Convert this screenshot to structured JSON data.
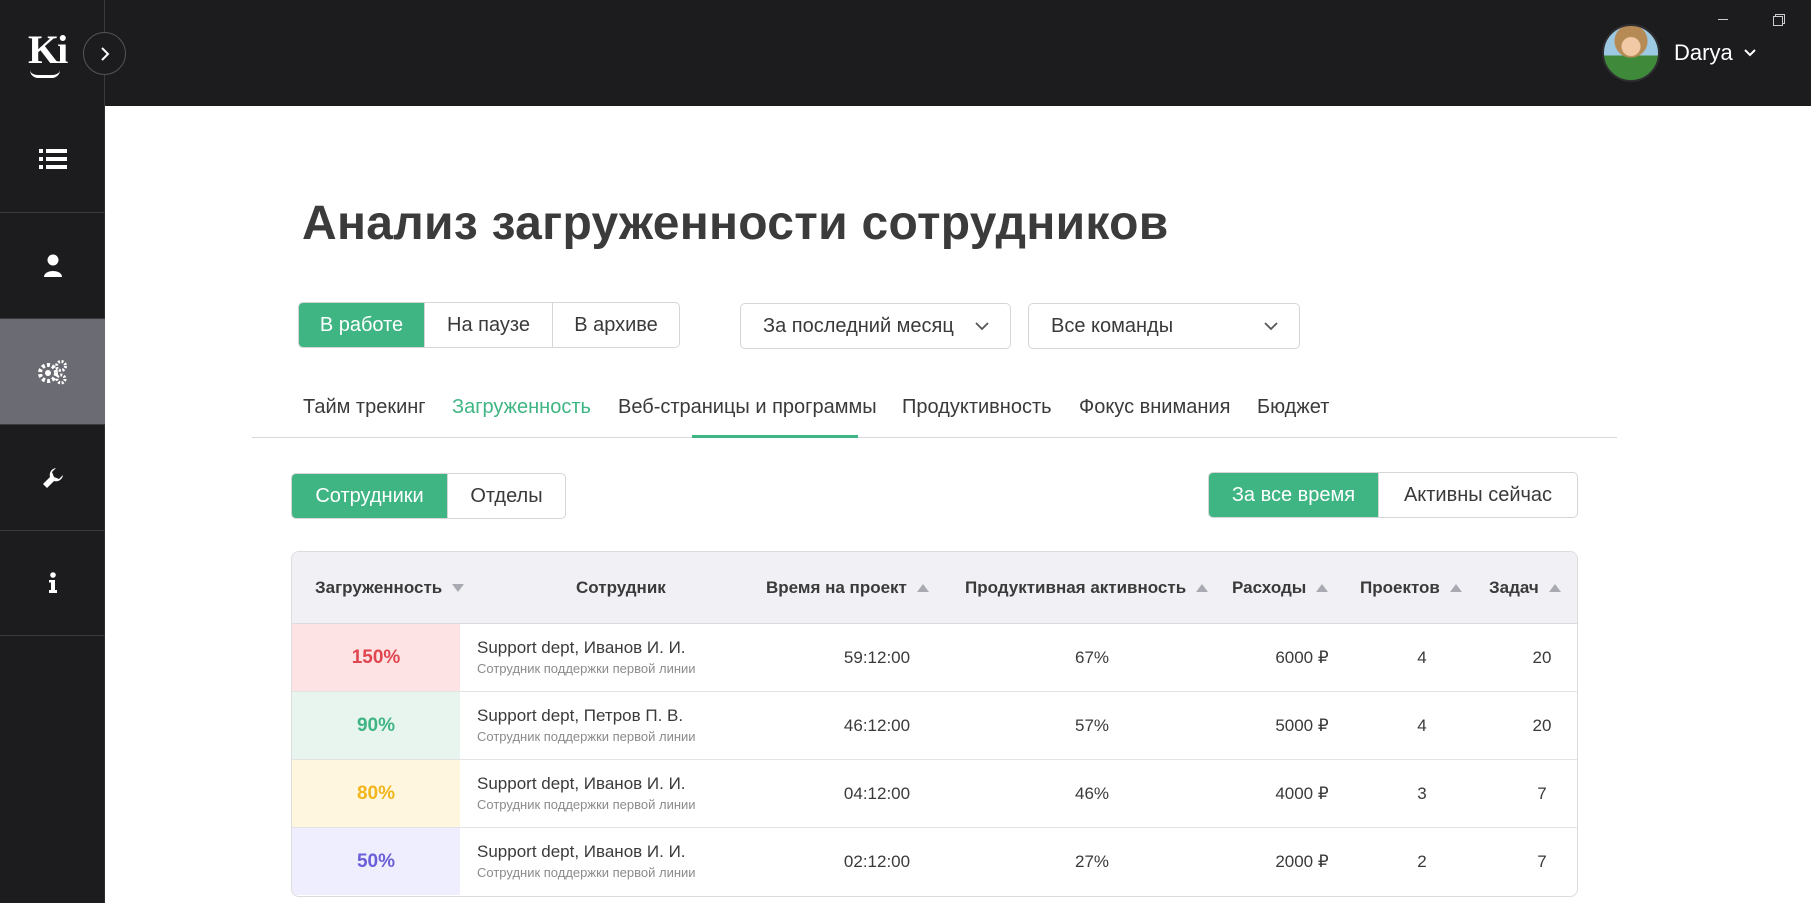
{
  "header": {
    "logo_text": "Ki",
    "user_name": "Darya",
    "icons": {
      "expand": "chevron-right-icon",
      "user_menu": "chevron-down-icon"
    }
  },
  "sidebar": {
    "items": [
      {
        "name": "list",
        "icon": "list-icon",
        "active": false
      },
      {
        "name": "user",
        "icon": "user-icon",
        "active": false
      },
      {
        "name": "settings",
        "icon": "gears-icon",
        "active": true
      },
      {
        "name": "tools",
        "icon": "wrench-icon",
        "active": false
      },
      {
        "name": "info",
        "icon": "info-icon",
        "active": false
      }
    ]
  },
  "page": {
    "title": "Анализ загруженности сотрудников"
  },
  "filters": {
    "status": [
      "В работе",
      "На паузе",
      "В архиве"
    ],
    "status_selected": "В работе",
    "period": "За последний месяц",
    "teams": "Все команды"
  },
  "tabs": [
    "Тайм трекинг",
    "Загруженность",
    "Веб-страницы и программы",
    "Продуктивность",
    "Фокус внимания",
    "Бюджет"
  ],
  "active_tab": "Загруженность",
  "view": {
    "options": [
      "Сотрудники",
      "Отделы"
    ],
    "selected": "Сотрудники"
  },
  "time_scope": {
    "options": [
      "За все время",
      "Активны сейчас"
    ],
    "selected": "За все время"
  },
  "table": {
    "columns": [
      "Загруженность",
      "Сотрудник",
      "Время на проект",
      "Продуктивная активность",
      "Расходы",
      "Проектов",
      "Задач"
    ],
    "rows": [
      {
        "load": "150%",
        "load_color": "#e0464f",
        "load_bg": "#fde3e3",
        "name": "Support dept, Иванов И. И.",
        "role": "Сотрудник поддержки первой линии",
        "time": "59:12:00",
        "productive": "67%",
        "expenses": "6000 ₽",
        "projects": "4",
        "tasks": "20"
      },
      {
        "load": "90%",
        "load_color": "#3fb583",
        "load_bg": "#e8f5ee",
        "name": "Support dept, Петров П. В.",
        "role": "Сотрудник поддержки первой линии",
        "time": "46:12:00",
        "productive": "57%",
        "expenses": "5000 ₽",
        "projects": "4",
        "tasks": "20"
      },
      {
        "load": "80%",
        "load_color": "#f2b61c",
        "load_bg": "#fff6df",
        "name": "Support dept, Иванов И. И.",
        "role": "Сотрудник поддержки первой линии",
        "time": "04:12:00",
        "productive": "46%",
        "expenses": "4000 ₽",
        "projects": "3",
        "tasks": "7"
      },
      {
        "load": "50%",
        "load_color": "#6a5fd8",
        "load_bg": "#efeefe",
        "name": "Support dept, Иванов И. И.",
        "role": "Сотрудник поддержки первой линии",
        "time": "02:12:00",
        "productive": "27%",
        "expenses": "2000 ₽",
        "projects": "2",
        "tasks": "7"
      }
    ]
  },
  "colors": {
    "accent": "#3fb583",
    "dark": "#1c1c1e",
    "sidebar_active": "#6b6b73"
  }
}
